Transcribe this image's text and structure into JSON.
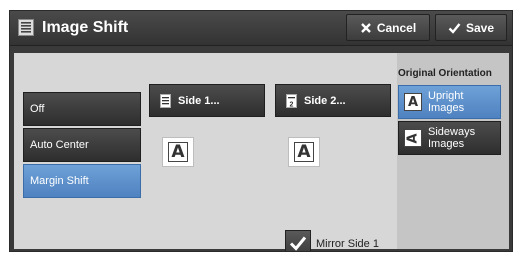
{
  "header": {
    "title": "Image Shift",
    "cancel_label": "Cancel",
    "save_label": "Save"
  },
  "shift_options": [
    {
      "label": "Off",
      "selected": false
    },
    {
      "label": "Auto Center",
      "selected": false
    },
    {
      "label": "Margin Shift",
      "selected": true
    }
  ],
  "sides": {
    "side1_label": "Side 1...",
    "side2_label": "Side 2...",
    "preview_glyph": "A"
  },
  "mirror": {
    "label": "Mirror Side 1",
    "checked": true
  },
  "orientation": {
    "title": "Original Orientation",
    "options": [
      {
        "label": "Upright Images",
        "glyph": "A",
        "selected": true
      },
      {
        "label": "Sideways Images",
        "glyph": "A",
        "selected": false
      }
    ]
  },
  "colors": {
    "selected": "#5b8fcb",
    "panel": "#d7d7d7",
    "chrome": "#3a3a3a"
  }
}
